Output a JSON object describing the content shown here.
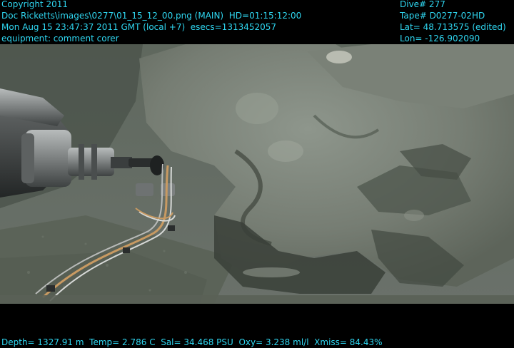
{
  "overlay": {
    "copyright": "Copyright 2011",
    "image_path": "Doc Ricketts\\images\\0277\\01_15_12_00.png (MAIN)  HD=01:15:12:00",
    "datetime": "Mon Aug 15 23:47:37 2011 GMT (local +7)  esecs=1313452057",
    "equipment": "equipment: comment corer",
    "dive": "Dive# 277",
    "tape": "Tape# D0277-02HD",
    "lat": "Lat= 48.713575 (edited)",
    "lon": "Lon= -126.902090",
    "sensors": "Depth= 1327.91 m  Temp= 2.786 C  Sal= 34.468 PSU  Oxy= 3.238 ml/l  Xmiss= 84.43%"
  },
  "colors": {
    "overlay_text": "#2fd6f0",
    "background": "#000000",
    "seafloor": "#5a6258"
  },
  "scene": {
    "description_icons": [
      "rov-manipulator-arm",
      "rock-outcrop",
      "sediment-seafloor",
      "cable-bundle"
    ]
  }
}
